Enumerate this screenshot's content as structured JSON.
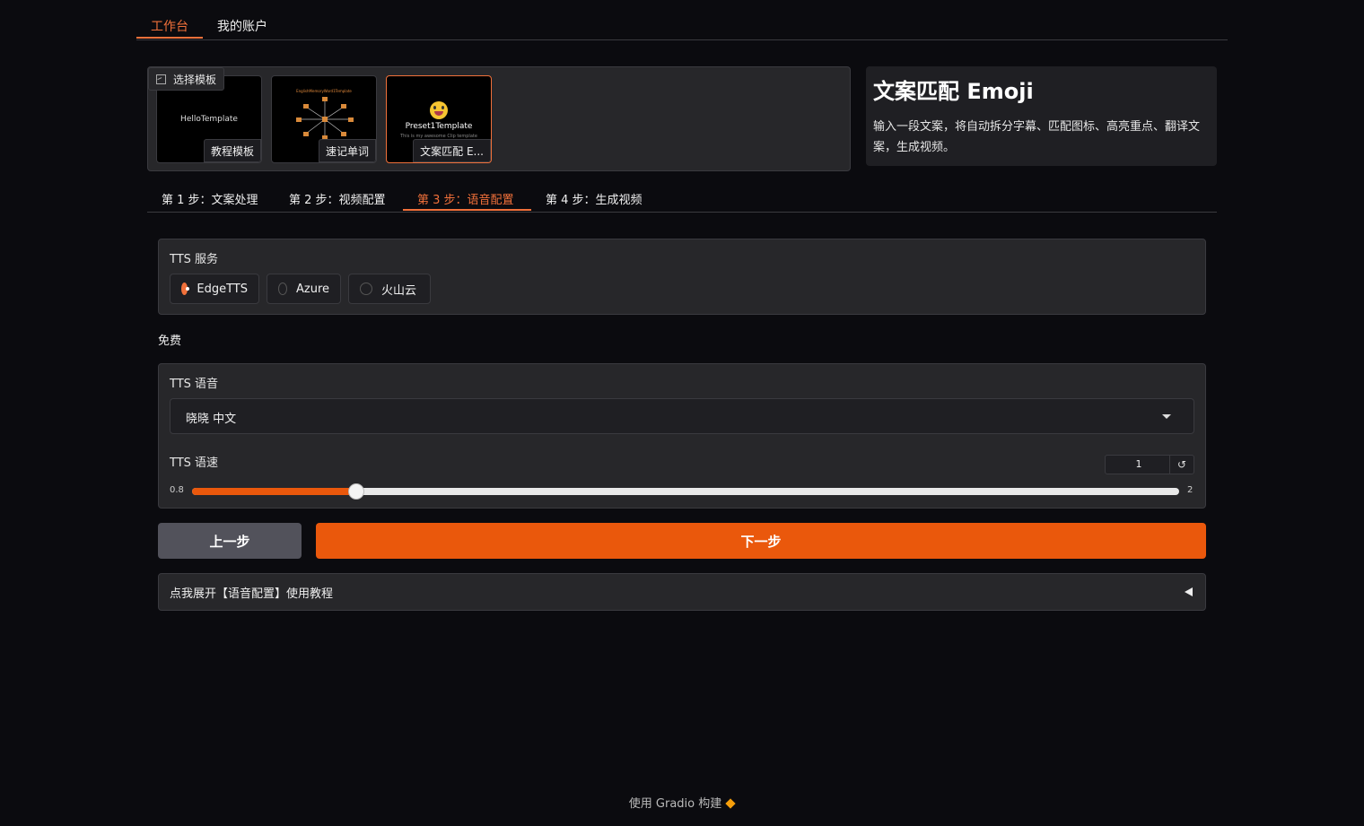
{
  "top_tabs": [
    {
      "label": "工作台",
      "active": true
    },
    {
      "label": "我的账户",
      "active": false
    }
  ],
  "gallery": {
    "label": "选择模板",
    "items": [
      {
        "caption": "教程模板",
        "preview_text": "HelloTemplate",
        "selected": false
      },
      {
        "caption": "速记单词",
        "preview_text": "EnglishMemoryWord1Template",
        "selected": false
      },
      {
        "caption": "文案匹配 E...",
        "preview_text": "Preset1Template",
        "preview_subtext": "This is my awesome Clip template",
        "selected": true
      }
    ]
  },
  "info": {
    "title": "文案匹配 Emoji",
    "description": "输入一段文案，将自动拆分字幕、匹配图标、高亮重点、翻译文案，生成视频。"
  },
  "steps": [
    {
      "label": "第 1 步：文案处理",
      "active": false
    },
    {
      "label": "第 2 步：视频配置",
      "active": false
    },
    {
      "label": "第 3 步：语音配置",
      "active": true
    },
    {
      "label": "第 4 步：生成视频",
      "active": false
    }
  ],
  "tts_service": {
    "label": "TTS 服务",
    "options": [
      {
        "label": "EdgeTTS",
        "selected": true
      },
      {
        "label": "Azure",
        "selected": false
      },
      {
        "label": "火山云",
        "selected": false
      }
    ]
  },
  "free_note": "免费",
  "tts_voice": {
    "label": "TTS 语音",
    "value": "晓晓 中文"
  },
  "tts_speed": {
    "label": "TTS 语速",
    "value": "1",
    "min": "0.8",
    "max": "2",
    "min_value": 0.8,
    "max_value": 2,
    "current": 1
  },
  "buttons": {
    "prev": "上一步",
    "next": "下一步"
  },
  "accordion": {
    "label": "点我展开【语音配置】使用教程"
  },
  "footer": {
    "text": "使用 Gradio 构建"
  },
  "colors": {
    "accent": "#ea580c",
    "background": "#0b0b0f",
    "panel": "#27272a"
  }
}
